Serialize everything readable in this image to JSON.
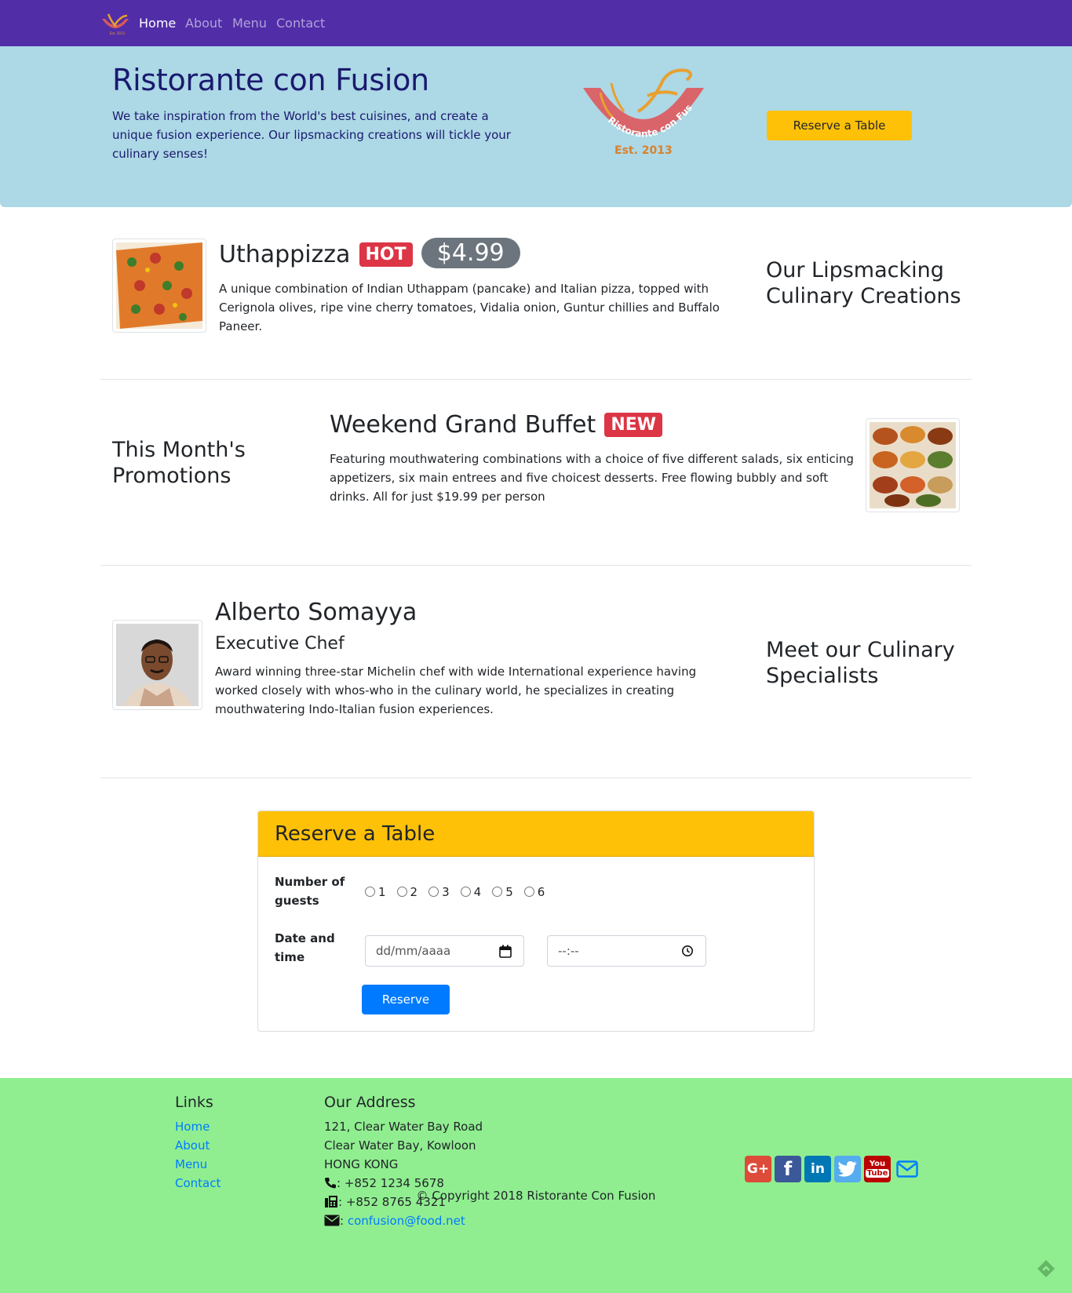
{
  "nav": {
    "items": [
      {
        "label": "Home",
        "active": true
      },
      {
        "label": "About",
        "active": false
      },
      {
        "label": "Menu",
        "active": false
      },
      {
        "label": "Contact",
        "active": false
      }
    ],
    "background": "#512DA8"
  },
  "jumbotron": {
    "title": "Ristorante con Fusion",
    "text": "We take inspiration from the World's best cuisines, and create a unique fusion experience. Our lipsmacking creations will tickle your culinary senses!",
    "logo_text": "Ristorante con Fusion",
    "logo_est": "Est. 2013",
    "reserve_button": "Reserve a Table",
    "background": "#ADD8E6"
  },
  "dish": {
    "name": "Uthappizza",
    "badge": "HOT",
    "price": "$4.99",
    "description": "A unique combination of Indian Uthappam (pancake) and Italian pizza, topped with Cerignola olives, ripe vine cherry tomatoes, Vidalia onion, Guntur chillies and Buffalo Paneer.",
    "section_heading": "Our Lipsmacking Culinary Creations"
  },
  "promotion": {
    "section_heading": "This Month's Promotions",
    "name": "Weekend Grand Buffet",
    "badge": "NEW",
    "description": "Featuring mouthwatering combinations with a choice of five different salads, six enticing appetizers, six main entrees and five choicest desserts. Free flowing bubbly and soft drinks. All for just $19.99 per person"
  },
  "leader": {
    "name": "Alberto Somayya",
    "designation": "Executive Chef",
    "description": "Award winning three-star Michelin chef with wide International experience having worked closely with whos-who in the culinary world, he specializes in creating mouthwatering Indo-Italian fusion experiences.",
    "section_heading": "Meet our Culinary Specialists"
  },
  "reserve": {
    "title": "Reserve a Table",
    "guests_label_line1": "Number of",
    "guests_label_line2": "guests",
    "guest_options": [
      "1",
      "2",
      "3",
      "4",
      "5",
      "6"
    ],
    "date_label_line1": "Date and",
    "date_label_line2": "time",
    "date_placeholder": "dd/mm/aaaa",
    "time_placeholder": "--:--",
    "button": "Reserve",
    "header_color": "#FFC107"
  },
  "footer": {
    "links_heading": "Links",
    "links": [
      "Home",
      "About",
      "Menu",
      "Contact"
    ],
    "address_heading": "Our Address",
    "address_lines": [
      "121, Clear Water Bay Road",
      "Clear Water Bay, Kowloon",
      "HONG KONG"
    ],
    "phone": ": +852 1234 5678",
    "fax": ": +852 8765 4321",
    "email_prefix": ":",
    "email": "confusion@food.net",
    "copyright": "© Copyright 2018 Ristorante Con Fusion",
    "social_icons": [
      "google-plus-icon",
      "facebook-icon",
      "linkedin-icon",
      "twitter-icon",
      "youtube-icon",
      "mail-icon"
    ],
    "background": "#90EE90"
  }
}
